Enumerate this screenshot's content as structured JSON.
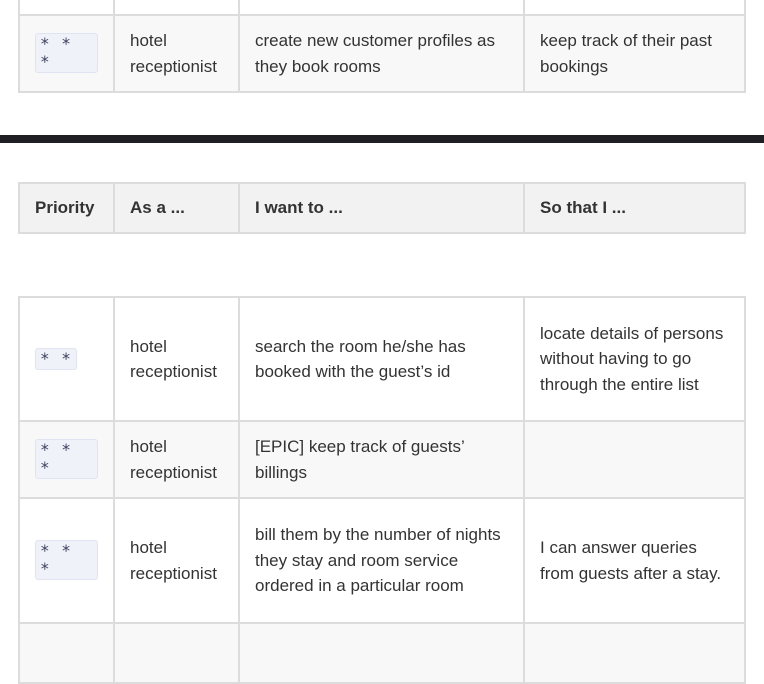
{
  "top_table": {
    "rows": [
      {
        "priority": "* * *",
        "role": "hotel receptionist",
        "want": "create new customer profiles as they book rooms",
        "benefit": "keep track of their past bookings"
      }
    ]
  },
  "header_table": {
    "headers": [
      "Priority",
      "As a ...",
      "I want to ...",
      "So that I ..."
    ]
  },
  "bottom_table": {
    "rows": [
      {
        "priority": "* *",
        "role": "hotel receptionist",
        "want": "search the room he/she has booked with the guest’s id",
        "benefit": "locate details of persons without having to go through the entire list"
      },
      {
        "priority": "* * *",
        "role": "hotel receptionist",
        "want": "[EPIC] keep track of guests’ billings",
        "benefit": ""
      },
      {
        "priority": "* * *",
        "role": "hotel receptionist",
        "want": "bill them by the number of nights they stay and room service ordered in a particular room",
        "benefit": "I can answer queries from guests after a stay."
      }
    ]
  }
}
